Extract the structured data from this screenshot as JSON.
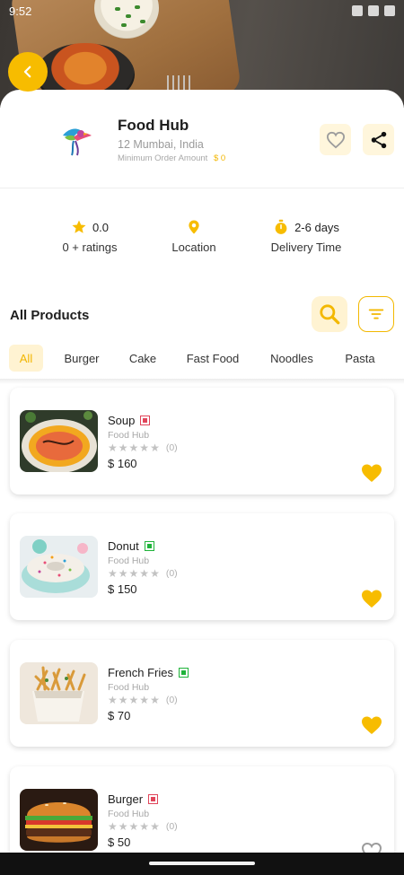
{
  "status_bar": {
    "time": "9:52"
  },
  "colors": {
    "accent": "#f7bc00",
    "accent_light": "#fff3d2",
    "veg": "#1fb33a",
    "nonveg": "#e0455a"
  },
  "restaurant": {
    "name": "Food Hub",
    "address": "12 Mumbai, India",
    "min_order_label": "Minimum Order Amount",
    "min_order_value": "$ 0"
  },
  "stats": {
    "rating_value": "0.0",
    "rating_label": "0 + ratings",
    "location_label": "Location",
    "delivery_value": "2-6 days",
    "delivery_label": "Delivery Time"
  },
  "products_header": "All Products",
  "categories": [
    "All",
    "Burger",
    "Cake",
    "Fast Food",
    "Noodles",
    "Pasta"
  ],
  "active_category": "All",
  "products": [
    {
      "name": "Soup",
      "vendor": "Food Hub",
      "rating_count": "(0)",
      "price": "$ 160",
      "diet": "non-veg",
      "favorite": true,
      "image": "soup"
    },
    {
      "name": "Donut",
      "vendor": "Food Hub",
      "rating_count": "(0)",
      "price": "$ 150",
      "diet": "veg",
      "favorite": true,
      "image": "donut"
    },
    {
      "name": "French Fries",
      "vendor": "Food Hub",
      "rating_count": "(0)",
      "price": "$ 70",
      "diet": "veg",
      "favorite": true,
      "image": "fries"
    },
    {
      "name": "Burger",
      "vendor": "Food Hub",
      "rating_count": "(0)",
      "price": "$ 50",
      "diet": "non-veg",
      "favorite": false,
      "image": "burger"
    }
  ],
  "icons": {
    "back": "chevron-left-icon",
    "favorite": "heart-outline-icon",
    "share": "share-icon",
    "rating": "star-icon",
    "location": "map-pin-icon",
    "delivery": "timer-icon",
    "search": "search-icon",
    "filter": "filter-icon"
  }
}
